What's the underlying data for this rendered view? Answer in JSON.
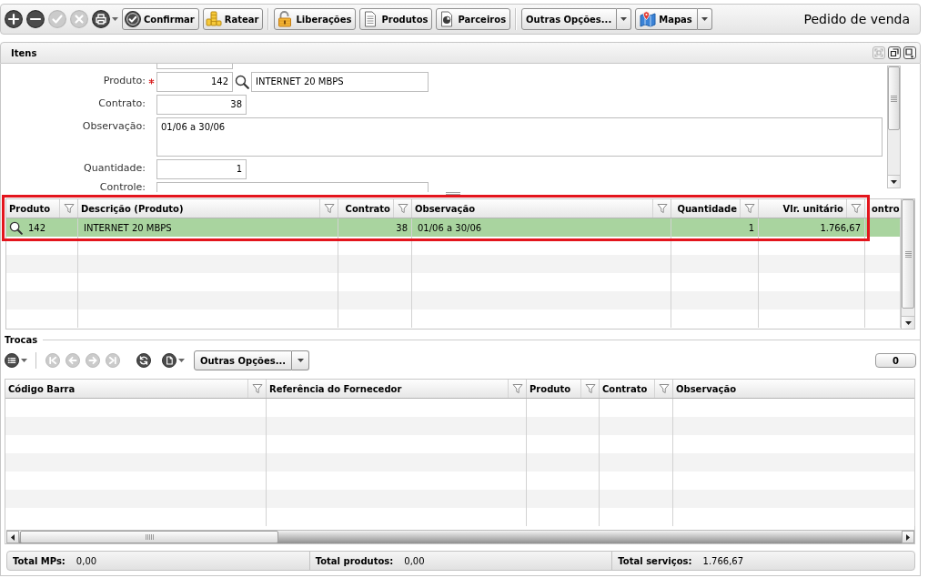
{
  "window": {
    "title": "Pedido de venda"
  },
  "toolbar": {
    "items": [
      {
        "kind": "round",
        "disabled": false,
        "menu": false
      },
      {
        "kind": "round",
        "disabled": false,
        "menu": false
      },
      {
        "kind": "round",
        "disabled": true,
        "menu": false
      },
      {
        "kind": "round",
        "disabled": true,
        "menu": false
      },
      {
        "kind": "round",
        "disabled": false,
        "menu": true
      },
      {
        "kind": "button",
        "label": "Confirmar",
        "disabled": false,
        "menu": false
      },
      {
        "kind": "button",
        "label": "Ratear",
        "disabled": false,
        "menu": false
      },
      {
        "kind": "separator"
      },
      {
        "kind": "button",
        "label": "Liberações",
        "disabled": false,
        "menu": false
      },
      {
        "kind": "button",
        "label": "Produtos",
        "disabled": false,
        "menu": false
      },
      {
        "kind": "button",
        "label": "Parceiros",
        "disabled": false,
        "menu": false
      },
      {
        "kind": "separator"
      },
      {
        "kind": "button",
        "label": "Outras Opções...",
        "disabled": false,
        "menu": true
      },
      {
        "kind": "button",
        "label": "Mapas",
        "disabled": false,
        "menu": true
      }
    ]
  },
  "itens_panel": {
    "title": "Itens",
    "controls": [
      {
        "disabled": true
      },
      {
        "disabled": false
      },
      {
        "disabled": false
      }
    ]
  },
  "form": {
    "fields": [
      {
        "kind": "clipped"
      },
      {
        "kind": "lookup",
        "label": "Produto:",
        "required": true,
        "value": "142",
        "description": "INTERNET 20 MBPS"
      },
      {
        "kind": "number",
        "label": "Contrato:",
        "required": false,
        "value": "38"
      },
      {
        "kind": "memo",
        "label": "Observação:",
        "required": false,
        "value": "01/06 a 30/06"
      },
      {
        "kind": "number",
        "label": "Quantidade:",
        "required": false,
        "value": "1"
      },
      {
        "kind": "text",
        "label": "Controle:",
        "required": false
      }
    ]
  },
  "items_grid": {
    "highlighted": true,
    "columns": [
      {
        "label": "Produto",
        "right_aligned": false,
        "filter": true,
        "lookup": true
      },
      {
        "label": "Descrição (Produto)",
        "right_aligned": false,
        "filter": true,
        "lookup": false
      },
      {
        "label": "Contrato",
        "right_aligned": true,
        "filter": true,
        "lookup": false
      },
      {
        "label": "Observação",
        "right_aligned": false,
        "filter": true,
        "lookup": false
      },
      {
        "label": "Quantidade",
        "right_aligned": true,
        "filter": true,
        "lookup": false
      },
      {
        "label": "Vlr. unitário",
        "right_aligned": true,
        "filter": true,
        "lookup": false
      },
      {
        "label": "ontro",
        "filter": false,
        "lookup": false
      }
    ],
    "rows": [
      {
        "selected": true,
        "cells": [
          "142",
          "INTERNET 20 MBPS",
          "38",
          "01/06 a 30/06",
          "1",
          "1.766,67"
        ]
      }
    ]
  },
  "trocas": {
    "title": "Trocas",
    "toolbar": {
      "items": [
        {
          "kind": "round",
          "disabled": false,
          "menu": true
        },
        {
          "kind": "separator"
        },
        {
          "kind": "round",
          "disabled": true,
          "menu": false
        },
        {
          "kind": "round",
          "disabled": true,
          "menu": false
        },
        {
          "kind": "round",
          "disabled": true,
          "menu": false
        },
        {
          "kind": "round",
          "disabled": true,
          "menu": false
        },
        {
          "kind": "round",
          "disabled": false,
          "menu": false
        },
        {
          "kind": "round",
          "disabled": false,
          "menu": true
        },
        {
          "kind": "button",
          "label": "Outras Opções...",
          "disabled": false,
          "menu": true
        }
      ]
    },
    "count": "0"
  },
  "trocas_grid": {
    "columns": [
      {
        "label": "Código Barra",
        "right_aligned": false,
        "filter": true
      },
      {
        "label": "Referência do Fornecedor",
        "right_aligned": false,
        "filter": true
      },
      {
        "label": "Produto",
        "right_aligned": false,
        "filter": true
      },
      {
        "label": "Contrato",
        "right_aligned": false,
        "filter": true
      },
      {
        "label": "Observação",
        "right_aligned": false,
        "filter": false
      }
    ]
  },
  "totals": [
    {
      "label": "Total MPs:",
      "value": "0,00"
    },
    {
      "label": "Total produtos:",
      "value": "0,00"
    },
    {
      "label": "Total serviços:",
      "value": "1.766,67"
    }
  ]
}
